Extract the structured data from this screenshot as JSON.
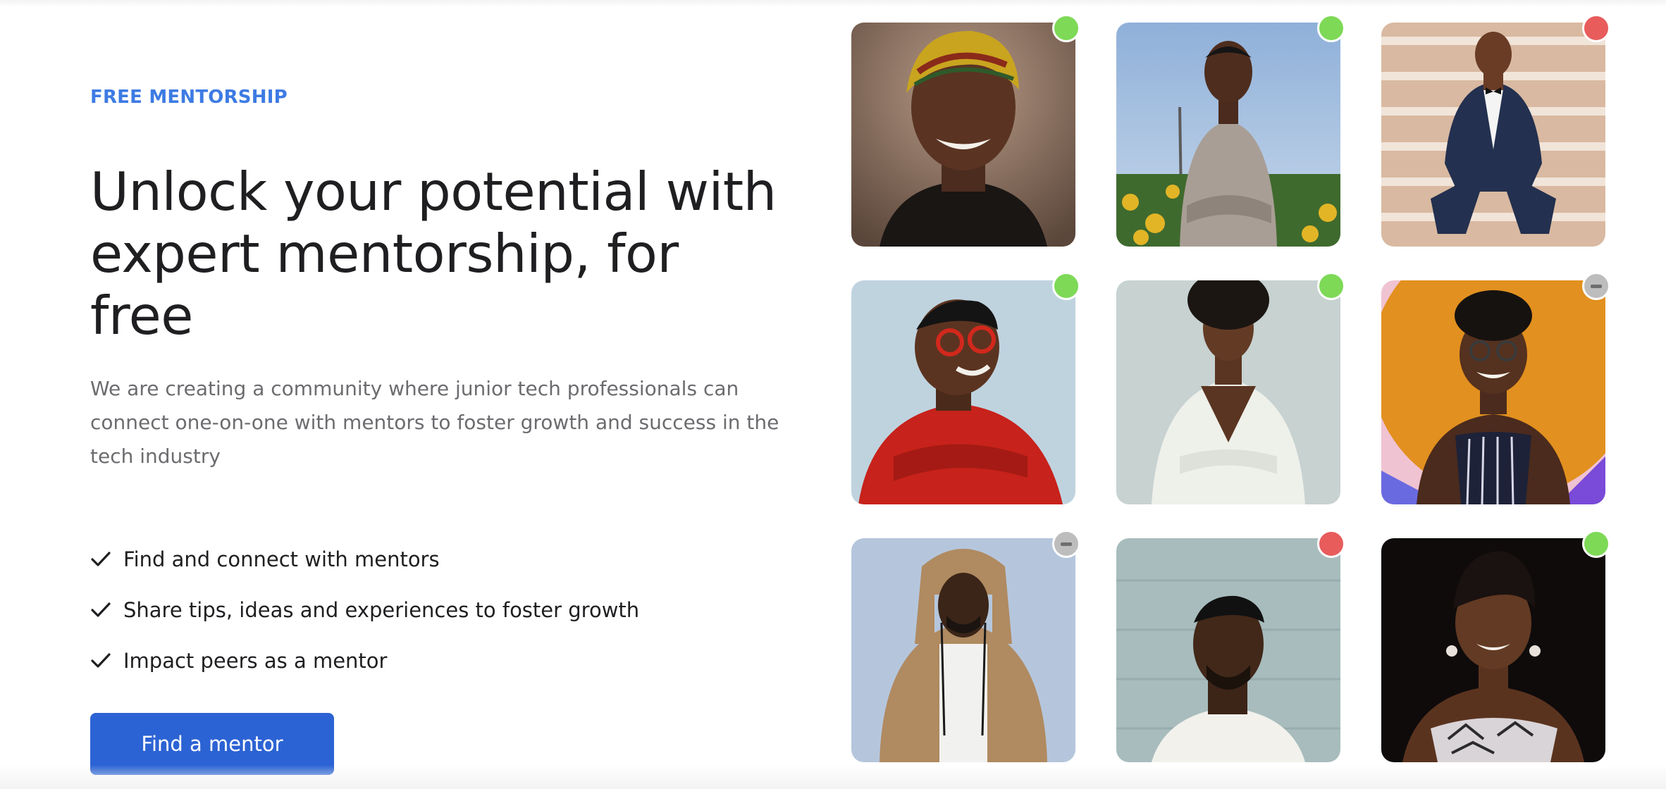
{
  "hero": {
    "eyebrow": "FREE MENTORSHIP",
    "headline_line1": "Unlock your potential with",
    "headline_line2": "expert mentorship, for free",
    "subtext": "We are creating a community where junior tech professionals can connect one-on-one with mentors to foster growth and success in the tech industry",
    "features": [
      "Find and connect with mentors",
      "Share tips, ideas and experiences to foster growth",
      "Impact peers as a mentor"
    ],
    "cta_label": "Find a mentor"
  },
  "colors": {
    "accent": "#2c63d4",
    "eyebrow": "#3d7be3",
    "online": "#7ed957",
    "busy": "#e85c5c",
    "away": "#bdbdbd"
  },
  "mentors": [
    {
      "status": "online",
      "photo": "woman-headwrap-smiling"
    },
    {
      "status": "online",
      "photo": "man-sweater-sunflowers"
    },
    {
      "status": "busy",
      "photo": "man-suit-stairs"
    },
    {
      "status": "online",
      "photo": "man-red-sweater-glasses"
    },
    {
      "status": "online",
      "photo": "woman-white-shirt"
    },
    {
      "status": "away",
      "photo": "woman-glasses-orange-backdrop"
    },
    {
      "status": "away",
      "photo": "man-hoodie"
    },
    {
      "status": "busy",
      "photo": "man-white-tee"
    },
    {
      "status": "online",
      "photo": "woman-dark-backdrop"
    }
  ]
}
